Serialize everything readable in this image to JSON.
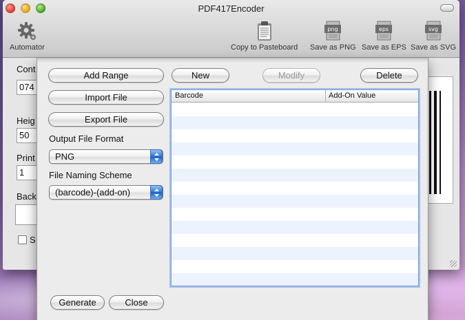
{
  "window": {
    "title": "PDF417Encoder"
  },
  "toolbar": {
    "automator": "Automator",
    "copy": "Copy to Pasteboard",
    "png": "Save as PNG",
    "eps": "Save as EPS",
    "svg": "Save as SVG",
    "png_icon_text": "png",
    "eps_icon_text": "eps",
    "svg_icon_text": "svg"
  },
  "background_form": {
    "content_label": "Cont",
    "content_value": "074",
    "height_label": "Heig",
    "height_value": "50",
    "print_label": "Print",
    "print_value": "1",
    "background_label": "Back",
    "checkbox_label": "S",
    "twitter_glyph": "t"
  },
  "sheet": {
    "add_range": "Add Range",
    "new": "New",
    "modify": "Modify",
    "delete": "Delete",
    "import_file": "Import File",
    "export_file": "Export File",
    "output_format_label": "Output File Format",
    "output_format_value": "PNG",
    "naming_label": "File Naming Scheme",
    "naming_value": "(barcode)-(add-on)",
    "generate": "Generate",
    "close": "Close"
  },
  "table": {
    "columns": [
      "Barcode",
      "Add-On Value"
    ],
    "rows": []
  },
  "colors": {
    "row_stripe": "#edf3fe",
    "selection_focus": "#9dc0ef",
    "popup_accent": "#2d74d8"
  }
}
